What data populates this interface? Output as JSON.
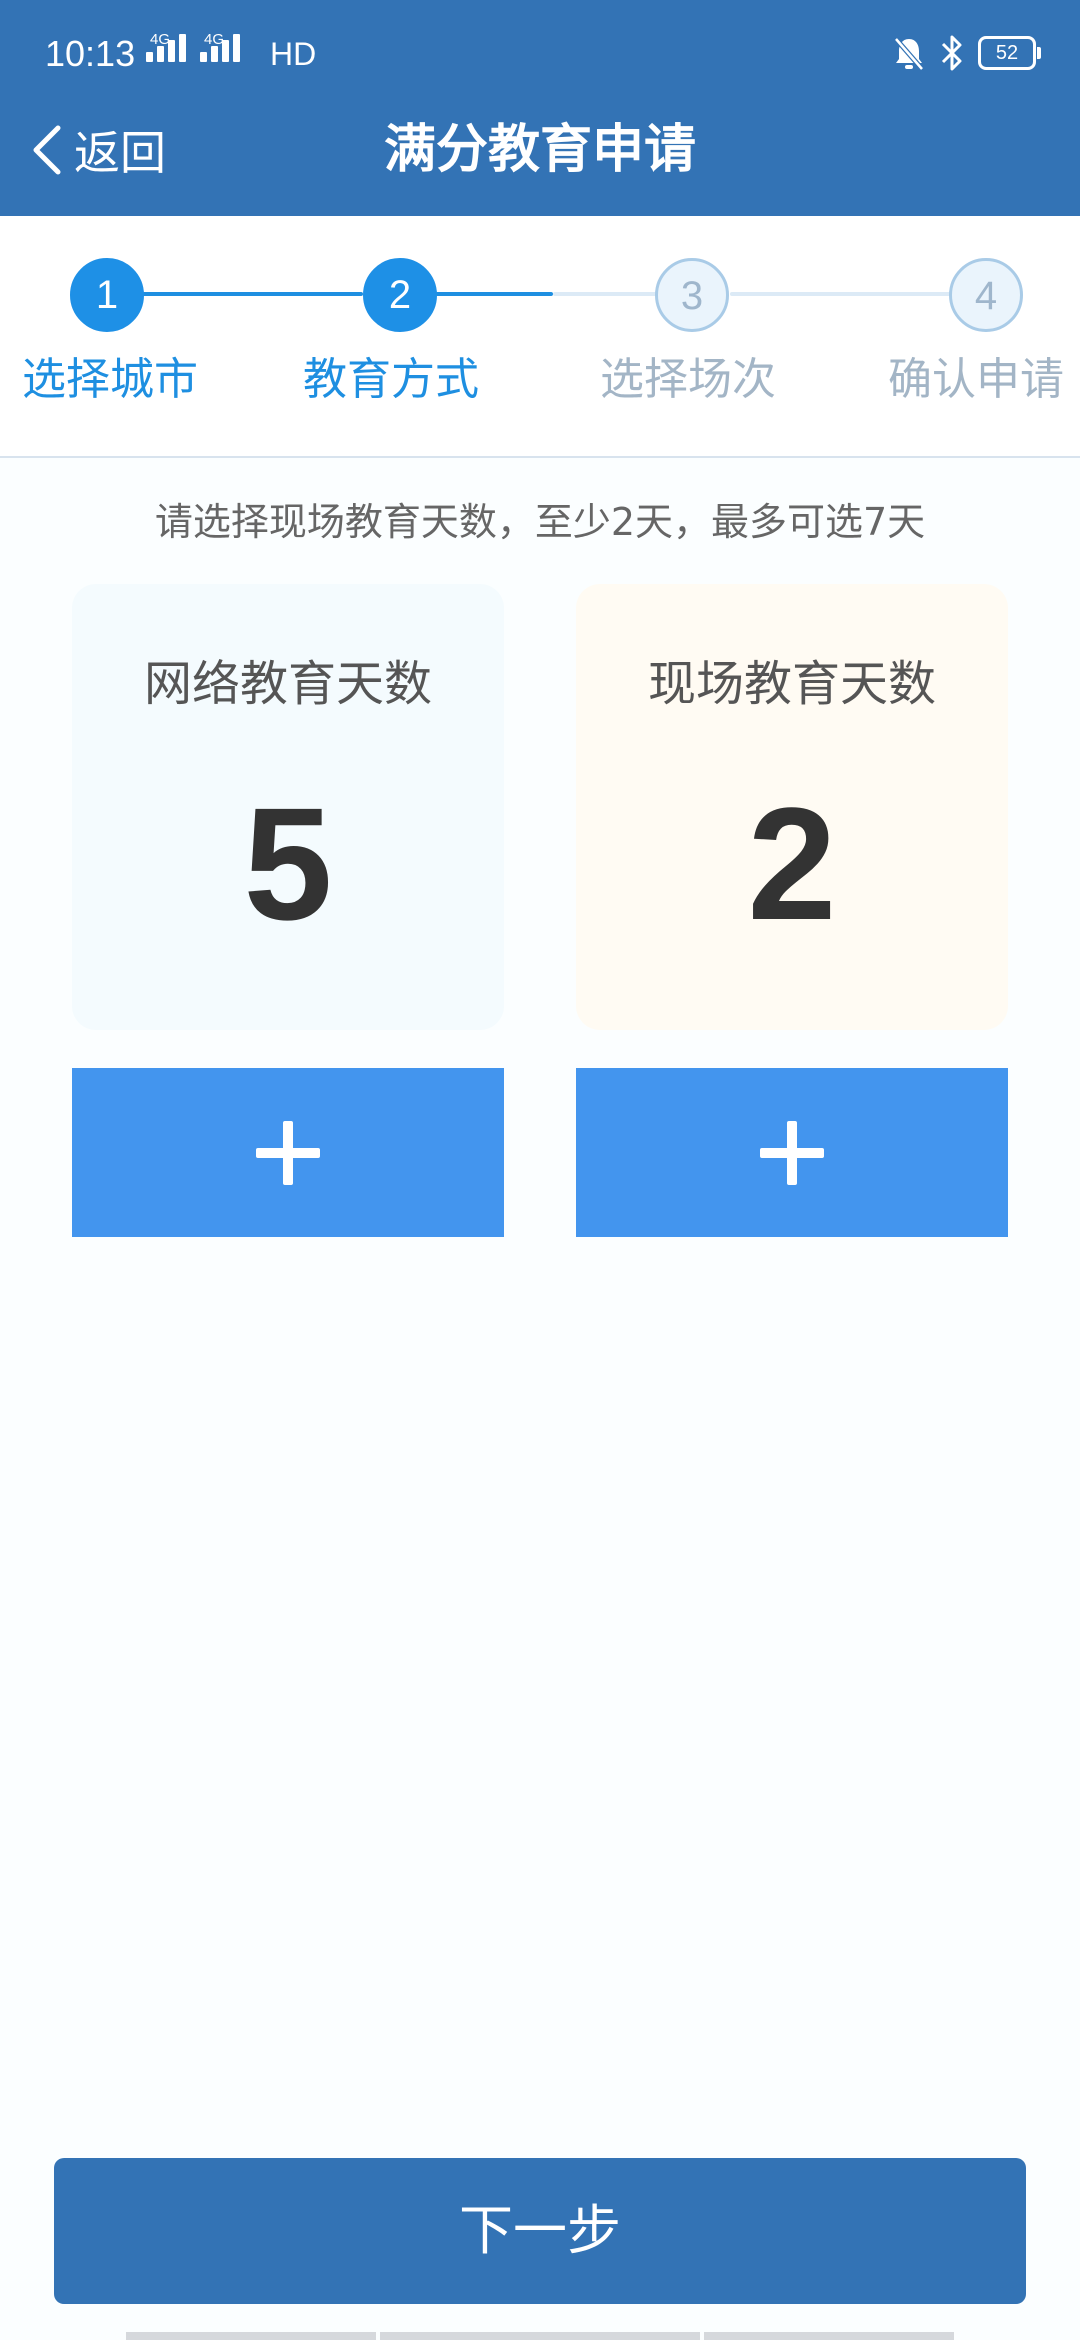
{
  "status_bar": {
    "time": "10:13",
    "network_1": "4G",
    "network_2": "4G",
    "hd_label": "HD",
    "battery": "52"
  },
  "nav": {
    "back_label": "返回",
    "title": "满分教育申请"
  },
  "steps": [
    {
      "number": "1",
      "label": "选择城市",
      "state": "active"
    },
    {
      "number": "2",
      "label": "教育方式",
      "state": "active"
    },
    {
      "number": "3",
      "label": "选择场次",
      "state": "inactive"
    },
    {
      "number": "4",
      "label": "确认申请",
      "state": "inactive"
    }
  ],
  "instruction": "请选择现场教育天数，至少2天，最多可选7天",
  "cards": {
    "online": {
      "title": "网络教育天数",
      "value": "5"
    },
    "onsite": {
      "title": "现场教育天数",
      "value": "2"
    }
  },
  "next_button": "下一步",
  "colors": {
    "header": "#3373b5",
    "accent": "#1e90e6",
    "plus_button": "#4395ee",
    "inactive_step": "#a3b5c6"
  }
}
